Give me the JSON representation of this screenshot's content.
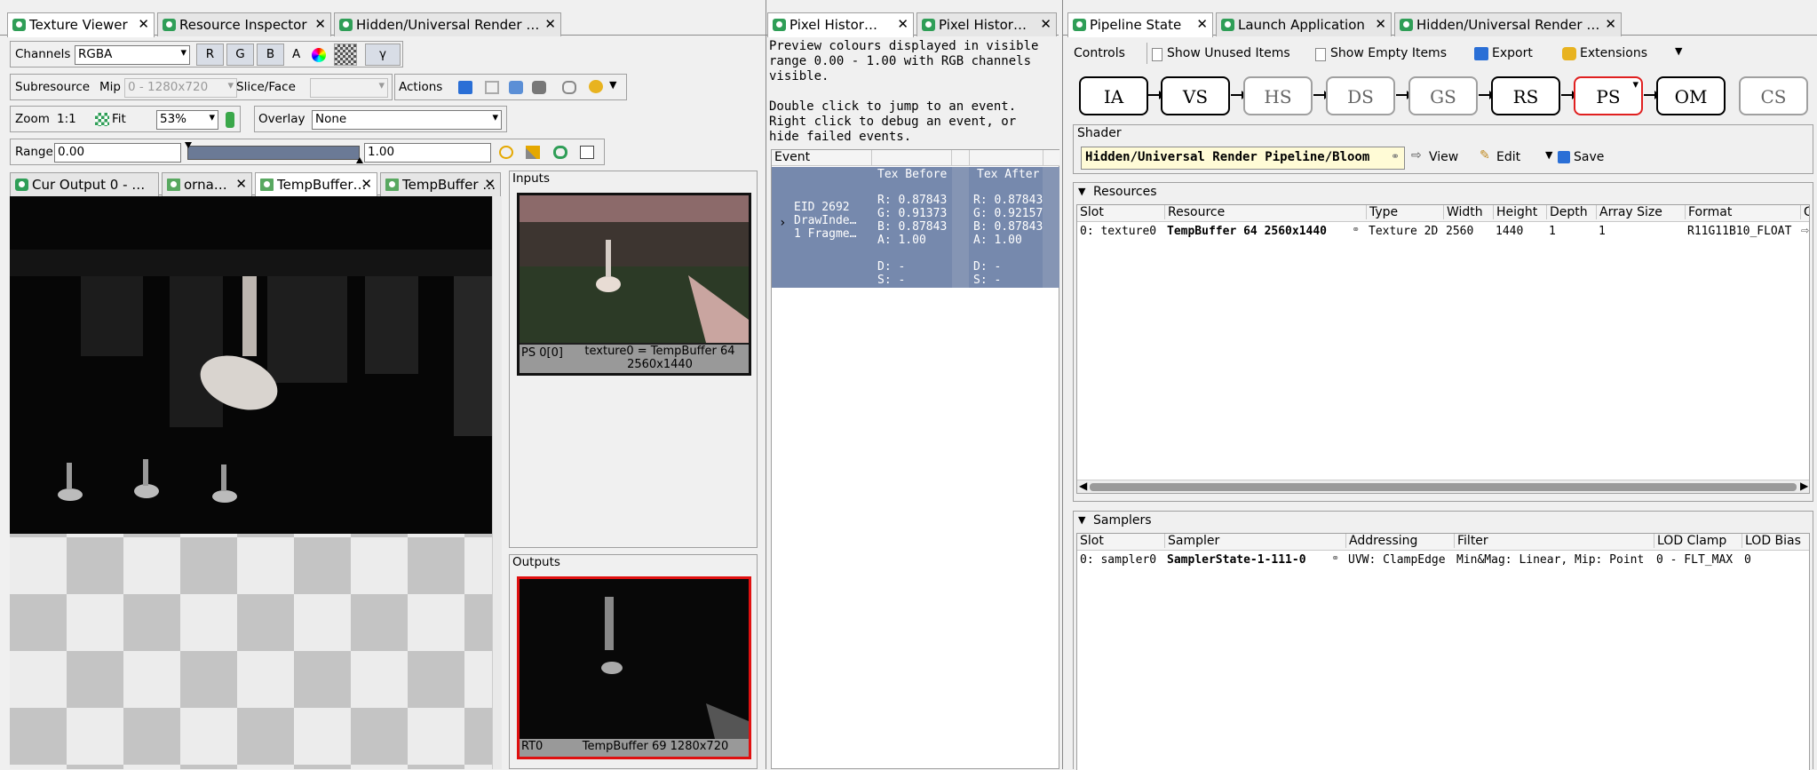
{
  "texture_viewer": {
    "tabs": [
      {
        "label": "Texture Viewer"
      },
      {
        "label": "Resource Inspector"
      },
      {
        "label": "Hidden/Universal Render …"
      }
    ],
    "toolbar": {
      "channels_label": "Channels",
      "channels_value": "RGBA",
      "r": "R",
      "g": "G",
      "b": "B",
      "a": "A",
      "gamma": "γ",
      "subresource_label": "Subresource",
      "mip_label": "Mip",
      "mip_value": "0 - 1280x720",
      "slice_label": "Slice/Face",
      "actions_label": "Actions",
      "zoom_label": "Zoom",
      "zoom_1to1": "1:1",
      "fit_label": "Fit",
      "zoom_value": "53%",
      "overlay_label": "Overlay",
      "overlay_value": "None",
      "range_label": "Range",
      "range_min": "0.00",
      "range_max": "1.00"
    },
    "subtabs": [
      {
        "label": "Cur Output 0 - …"
      },
      {
        "label": "orna…"
      },
      {
        "label": "TempBuffer…"
      },
      {
        "label": "TempBuffer …"
      }
    ],
    "inputs_label": "Inputs",
    "input_thumb_slot": "PS 0[0]",
    "input_thumb_name": "texture0 = TempBuffer 64 2560x1440",
    "outputs_label": "Outputs",
    "output_thumb_slot": "RT0",
    "output_thumb_name": "TempBuffer 69 1280x720"
  },
  "pixel_history": {
    "tabs": [
      {
        "label": "Pixel Histor…"
      },
      {
        "label": "Pixel Histor…"
      }
    ],
    "desc1": "Preview colours displayed in visible range 0.00 - 1.00 with RGB channels visible.",
    "desc2": "Double click to jump to an event.",
    "desc3": "Right click to debug an event, or hide failed events.",
    "col_event": "Event",
    "event": {
      "id": "EID 2692",
      "name": "DrawInde…",
      "frag": "1 Fragme…",
      "tex_before_label": "Tex Before",
      "tex_after_label": "Tex After",
      "before": [
        "R: 0.87843",
        "G: 0.91373",
        "B: 0.87843",
        "A: 1.00",
        "",
        "D: -",
        "S: -"
      ],
      "after": [
        "R: 0.87843",
        "G: 0.92157",
        "B: 0.87843",
        "A: 1.00",
        "",
        "D: -",
        "S: -"
      ]
    }
  },
  "pipeline": {
    "tabs": [
      {
        "label": "Pipeline State"
      },
      {
        "label": "Launch Application"
      },
      {
        "label": "Hidden/Universal Render …"
      }
    ],
    "toolbar": {
      "controls": "Controls",
      "show_unused": "Show Unused Items",
      "show_empty": "Show Empty Items",
      "export": "Export",
      "extensions": "Extensions"
    },
    "stages": [
      "IA",
      "VS",
      "HS",
      "DS",
      "GS",
      "RS",
      "PS",
      "OM",
      "CS"
    ],
    "shader_label": "Shader",
    "shader_name": "Hidden/Universal Render Pipeline/Bloom",
    "view": "View",
    "edit": "Edit",
    "save": "Save",
    "resources_label": "Resources",
    "resources_cols": [
      "Slot",
      "Resource",
      "Type",
      "Width",
      "Height",
      "Depth",
      "Array Size",
      "Format",
      "Go"
    ],
    "resources_rows": [
      [
        "0: texture0",
        "TempBuffer 64 2560x1440",
        "Texture 2D",
        "2560",
        "1440",
        "1",
        "1",
        "R11G11B10_FLOAT"
      ]
    ],
    "samplers_label": "Samplers",
    "samplers_cols": [
      "Slot",
      "Sampler",
      "Addressing",
      "Filter",
      "LOD Clamp",
      "LOD Bias"
    ],
    "samplers_rows": [
      [
        "0: sampler0",
        "SamplerState-1-111-0",
        "UVW: ClampEdge",
        "Min&Mag: Linear, Mip: Point",
        "0 - FLT_MAX",
        "0"
      ]
    ]
  }
}
